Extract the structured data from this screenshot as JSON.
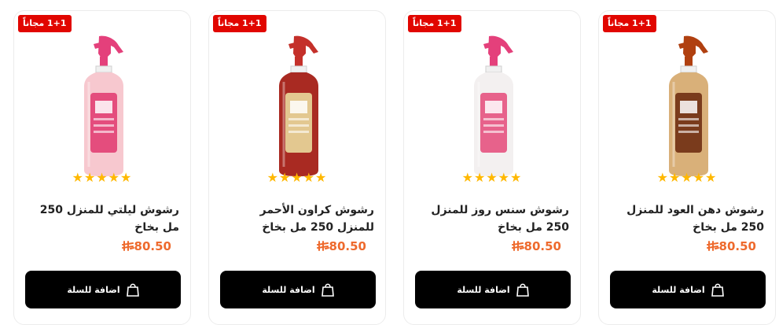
{
  "products": [
    {
      "badge": "1+1 مجاناً",
      "title": "رشوش دهن العود للمنزل 250 مل بخاخ",
      "rating_stars": 5,
      "price": "80.50",
      "add_to_cart": "اضافة للسلة",
      "colors": {
        "nozzle": "#b04010",
        "body": "#d9b079",
        "label": "#7a3b1c"
      }
    },
    {
      "badge": "1+1 مجاناً",
      "title": "رشوش سنس روز للمنزل 250 مل بخاخ",
      "rating_stars": 5,
      "price": "80.50",
      "add_to_cart": "اضافة للسلة",
      "colors": {
        "nozzle": "#e4407b",
        "body": "#f3f0f0",
        "label": "#e7628b"
      }
    },
    {
      "badge": "1+1 مجاناً",
      "title": "رشوش كراون الأحمر للمنزل 250 مل بخاخ",
      "rating_stars": 5,
      "price": "80.50",
      "add_to_cart": "اضافة للسلة",
      "colors": {
        "nozzle": "#c4302a",
        "body": "#a92a22",
        "label": "#e3c890"
      }
    },
    {
      "badge": "1+1 مجاناً",
      "title": "رشوش ليلتي للمنزل 250 مل بخاخ",
      "rating_stars": 5,
      "price": "80.50",
      "add_to_cart": "اضافة للسلة",
      "colors": {
        "nozzle": "#e4407b",
        "body": "#f7c8cf",
        "label": "#e44d7d"
      }
    }
  ],
  "theme": {
    "accent": "#ee6a2d",
    "badge": "#e10600",
    "star": "#ffb800"
  }
}
